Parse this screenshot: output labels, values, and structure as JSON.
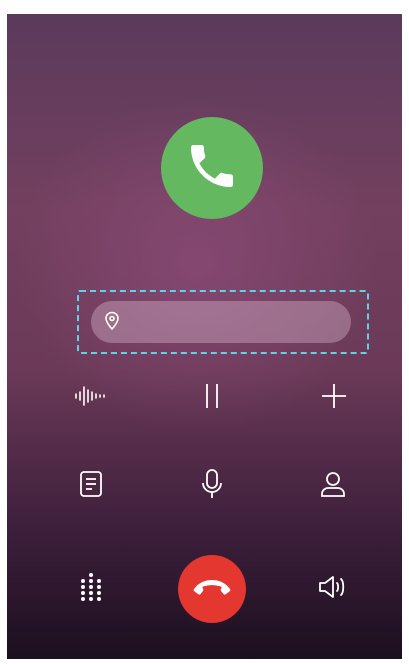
{
  "call": {
    "status_icon": "phone-icon",
    "location_text": ""
  },
  "controls": {
    "row1": [
      "voice-wave-icon",
      "pause-icon",
      "add-icon"
    ],
    "row2": [
      "notes-icon",
      "microphone-icon",
      "contact-icon"
    ],
    "row3": [
      "dialpad-icon",
      "end-call-icon",
      "speaker-icon"
    ]
  },
  "colors": {
    "accept_green": "#63b860",
    "end_red": "#e3372f",
    "highlight": "#5ed3e6"
  }
}
